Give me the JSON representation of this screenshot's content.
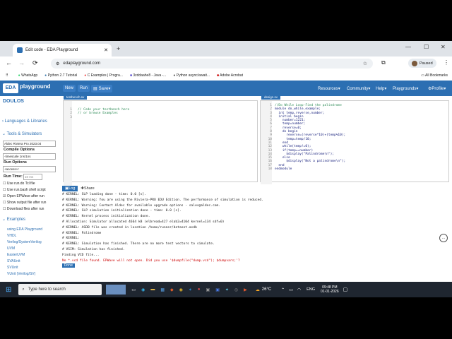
{
  "browser": {
    "tab_title": "Edit code - EDA Playground",
    "url": "edaplayground.com",
    "profile_label": "Paused",
    "bookmarks": [
      "WhatsApp",
      "Python 2.7 Tutorial",
      "C Examples | Progra...",
      "3zddaahe8 - Java -...",
      "Python async/await...",
      "Adobe Acrobat"
    ],
    "all_bookmarks": "All Bookmarks"
  },
  "topbar": {
    "logo_top": "EDA",
    "logo_bottom": "playground",
    "new": "New",
    "run": "Run",
    "save": "Save",
    "resources": "Resources",
    "community": "Community",
    "help": "Help",
    "playgrounds": "Playgrounds",
    "profile": "Profile"
  },
  "sidebar": {
    "doulos": "DOULOS",
    "languages": "Languages & Libraries",
    "tools": "Tools & Simulators",
    "tool_select": "Aldec Riviera Pro 2023.04",
    "compile_options": "Compile Options",
    "compile_value": "-timescale 1ns/1ns",
    "run_options": "Run Options",
    "run_value": "+access+r",
    "run_time_label": "Run Time:",
    "run_time_value": "10 ms",
    "checks": [
      "Use run.do Tcl file",
      "Use run.bash shell script",
      "Open EPWave after run",
      "Show output file after run",
      "Download files after run"
    ],
    "examples": "Examples",
    "links": [
      "using EDA Playground",
      "VHDL",
      "Verilog/SystemVerilog",
      "UVM",
      "EasierUVM",
      "SVAUnit",
      "SVUnit",
      "VUnit (Verilog/SV)"
    ]
  },
  "testbench": {
    "tab": "testbench.sv",
    "lines": [
      "// Code your testbench here",
      "// or browse Examples"
    ]
  },
  "design": {
    "tab": "design.sv",
    "lines": [
      "//Do While Loop-Find the palindrome",
      "module do_while_example;",
      "  int temp,reverse,number;",
      "  initial begin",
      "    number=1221;",
      "    temp=number;",
      "    reverse=0;",
      "    do begin",
      "      reverse=(reverse*10)+(temp%10);",
      "      temp=temp/10;",
      "    end",
      "    while(temp!=0);",
      "    if(temp==number)",
      "      $display(\"Palindrome\\n\");",
      "    else",
      "      $display(\"Not a palindrome\\n\");",
      "  end",
      "endmodule"
    ]
  },
  "log_tabs": {
    "log": "Log",
    "share": "Share"
  },
  "log_lines": [
    "# KERNEL: SLP loading done - time: 0.0 [s].",
    "# KERNEL: Warning: You are using the Riviera-PRO EDU Edition. The performance of simulation is reduced.",
    "# KERNEL: Warning: Contact Aldec for available upgrade options - sales@aldec.com.",
    "# KERNEL: SLP simulation initialization done - time: 0.0 [s].",
    "# KERNEL: Kernel process initialization done.",
    "# Allocation: Simulator allocated 4664 kB (elbread=427 elab2=4104 kernel=134 sdf=0)",
    "# KERNEL: ASDB file was created in location /home/runner/dataset.asdb",
    "# KERNEL: Palindrome",
    "# KERNEL:",
    "# KERNEL: Simulation has finished. There are no more test vectors to simulate.",
    "# VSIM: Simulation has finished.",
    "Finding VCD file...",
    "No *.vcd file found. EPWave will not open. Did you use '$dumpfile(\"dump.vcd\"); $dumpvars;'?"
  ],
  "done_label": "Done",
  "taskbar": {
    "search": "Type here to search",
    "temp": "26°C",
    "lang": "ENG",
    "time": "09:48 PM",
    "date": "01-01-2026"
  },
  "colors": {
    "accent": "#2c6fb2",
    "comment": "#2e8b57",
    "keyword": "#7a1fa2"
  }
}
